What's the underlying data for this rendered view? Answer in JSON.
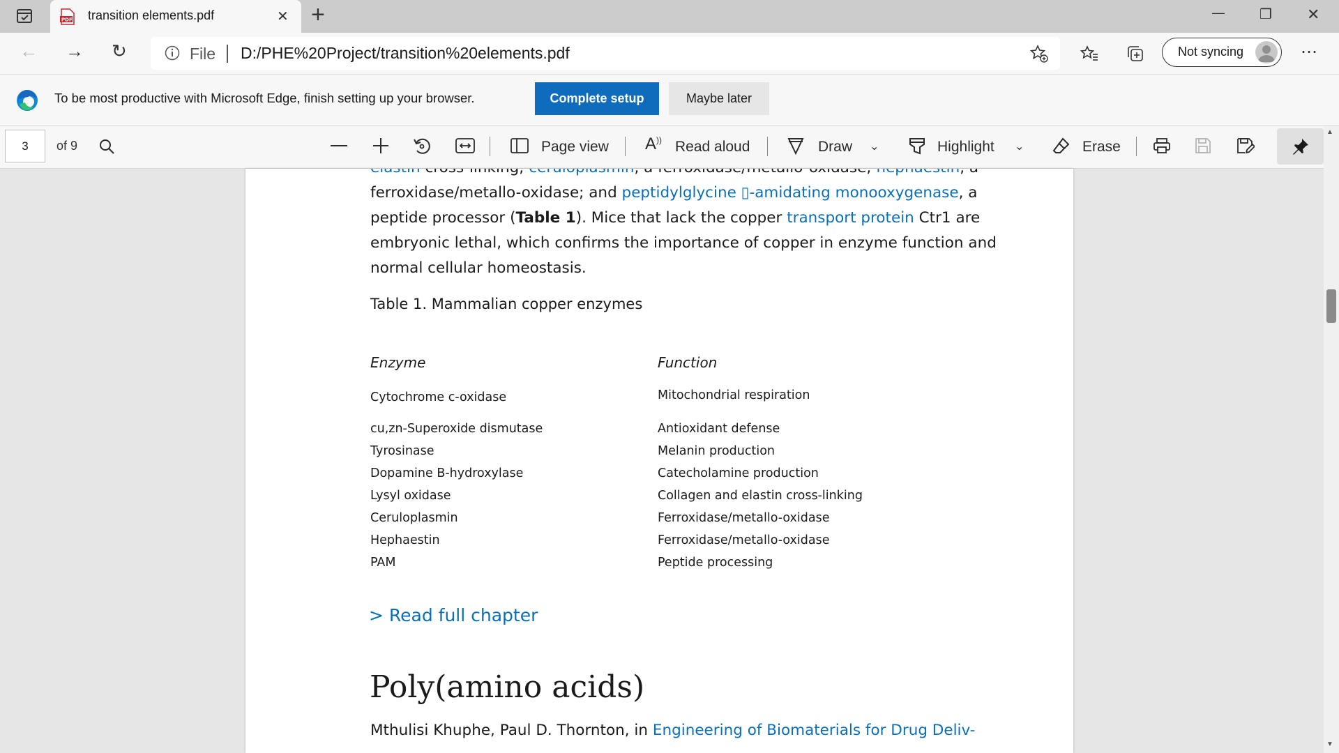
{
  "browser": {
    "tab": {
      "title": "transition elements.pdf",
      "icon": "pdf-file-icon",
      "close_glyph": "✕"
    },
    "new_tab_glyph": "+",
    "window": {
      "minimize": "—",
      "restore": "❐",
      "close": "✕"
    },
    "address": {
      "info_label": "File",
      "url": "D:/PHE%20Project/transition%20elements.pdf"
    },
    "sync_label": "Not syncing"
  },
  "infobar": {
    "message": "To be most productive with Microsoft Edge, finish setting up your browser.",
    "complete_label": "Complete setup",
    "later_label": "Maybe later"
  },
  "pdf_toolbar": {
    "page_number": "3",
    "page_total": "of 9",
    "page_view_label": "Page view",
    "read_aloud_label": "Read aloud",
    "draw_label": "Draw",
    "highlight_label": "Highlight",
    "erase_label": "Erase"
  },
  "document": {
    "line0": {
      "link1": "elastin",
      "t1": " cross-linking; ",
      "link2": "ceruloplasmin",
      "t2": ", a ferroxidase/metallo-oxidase; ",
      "link3": "hephaestin",
      "t3": ", a"
    },
    "line1": {
      "t1": "ferroxidase/metallo-oxidase; and ",
      "link1": "peptidylglycine ▯-amidating monooxygenase",
      "t2": ", a"
    },
    "line2": {
      "t1": "peptide processor (",
      "bold": "Table 1",
      "t2": "). Mice that lack the copper ",
      "link1": "transport protein",
      "t3": " Ctr1 are"
    },
    "line3": "embryonic lethal, which confirms the importance of copper in enzyme function and",
    "line4": "normal cellular homeostasis.",
    "table_caption": "Table 1. Mammalian copper enzymes",
    "table": {
      "headers": [
        "Enzyme",
        "Function"
      ],
      "rows": [
        [
          "Cytochrome c-oxidase",
          "Mitochondrial respiration"
        ],
        [
          "cu,zn-Superoxide dismutase",
          "Antioxidant defense"
        ],
        [
          "Tyrosinase",
          "Melanin production"
        ],
        [
          "Dopamine B-hydroxylase",
          "Catecholamine production"
        ],
        [
          "Lysyl oxidase",
          "Collagen and elastin cross-linking"
        ],
        [
          "Ceruloplasmin",
          "Ferroxidase/metallo-oxidase"
        ],
        [
          "Hephaestin",
          "Ferroxidase/metallo-oxidase"
        ],
        [
          "PAM",
          "Peptide processing"
        ]
      ]
    },
    "read_full": "> Read full chapter",
    "heading": "Poly(amino acids)",
    "authors": {
      "t1": "Mthulisi Khuphe, Paul D. Thornton, in ",
      "link1": "Engineering of Biomaterials for Drug Deliv-"
    }
  }
}
